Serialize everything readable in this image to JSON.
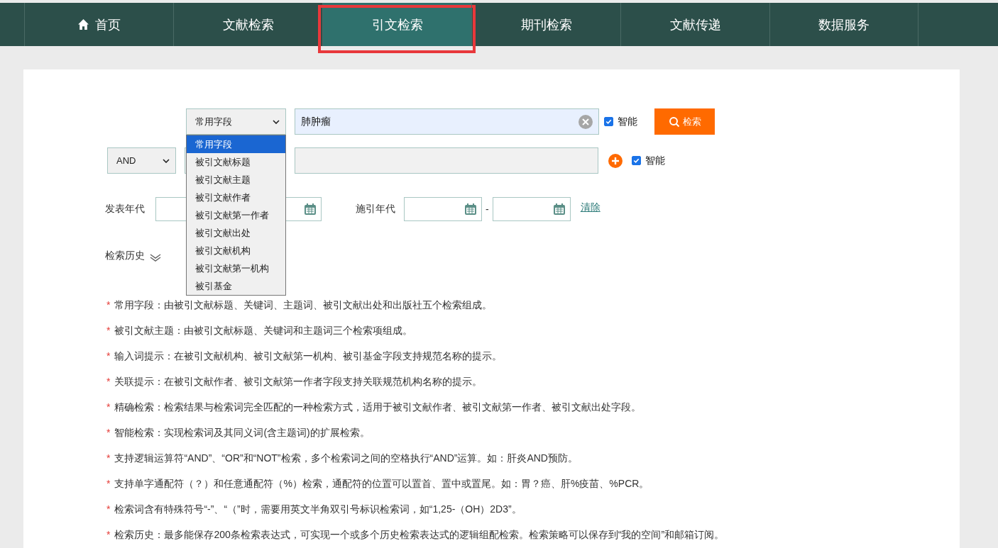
{
  "nav": {
    "tabs": [
      {
        "label": "首页",
        "kind": "home",
        "selected": false,
        "highlighted": false
      },
      {
        "label": "文献检索",
        "kind": "plain",
        "selected": false,
        "highlighted": false
      },
      {
        "label": "引文检索",
        "kind": "plain",
        "selected": true,
        "highlighted": true
      },
      {
        "label": "期刊检索",
        "kind": "plain",
        "selected": false,
        "highlighted": false
      },
      {
        "label": "文献传递",
        "kind": "plain",
        "selected": false,
        "highlighted": false
      },
      {
        "label": "数据服务",
        "kind": "plain",
        "selected": false,
        "highlighted": false
      }
    ]
  },
  "search": {
    "row1": {
      "field": "常用字段",
      "value": "肺肿瘤",
      "smart_label": "智能",
      "smart_checked": true,
      "button": "检索"
    },
    "row2": {
      "operator": "AND",
      "smart_label": "智能",
      "smart_checked": true
    },
    "field_dropdown": {
      "options": [
        {
          "label": "常用字段",
          "selected": true
        },
        {
          "label": "被引文献标题",
          "selected": false
        },
        {
          "label": "被引文献主题",
          "selected": false
        },
        {
          "label": "被引文献作者",
          "selected": false
        },
        {
          "label": "被引文献第一作者",
          "selected": false
        },
        {
          "label": "被引文献出处",
          "selected": false
        },
        {
          "label": "被引文献机构",
          "selected": false
        },
        {
          "label": "被引文献第一机构",
          "selected": false
        },
        {
          "label": "被引基金",
          "selected": false
        }
      ]
    },
    "publish_years_label": "发表年代",
    "citing_years_label": "施引年代",
    "range_separator": "-",
    "clear_link": "清除",
    "history_label": "检索历史"
  },
  "notes": [
    {
      "marker": "*",
      "text": "常用字段：由被引文献标题、关键词、主题词、被引文献出处和出版社五个检索组成。"
    },
    {
      "marker": "*",
      "text": "被引文献主题：由被引文献标题、关键词和主题词三个检索项组成。"
    },
    {
      "marker": "*",
      "text": "输入词提示：在被引文献机构、被引文献第一机构、被引基金字段支持规范名称的提示。"
    },
    {
      "marker": "*",
      "text": "关联提示：在被引文献作者、被引文献第一作者字段支持关联规范机构名称的提示。"
    },
    {
      "marker": "*",
      "text": "精确检索：检索结果与检索词完全匹配的一种检索方式，适用于被引文献作者、被引文献第一作者、被引文献出处字段。"
    },
    {
      "marker": "*",
      "text": "智能检索：实现检索词及其同义词(含主题词)的扩展检索。"
    },
    {
      "marker": "*",
      "text": "支持逻辑运算符“AND”、“OR”和“NOT”检索，多个检索词之间的空格执行“AND”运算。如：肝炎AND预防。"
    },
    {
      "marker": "*",
      "text": "支持单字通配符（？）和任意通配符（%）检索，通配符的位置可以置首、置中或置尾。如：胃？癌、肝%疫苗、%PCR。"
    },
    {
      "marker": "*",
      "text": "检索词含有特殊符号“-”、“（”时，需要用英文半角双引号标识检索词，如“1,25-（OH）2D3”。"
    },
    {
      "marker": "*",
      "text": "检索历史：最多能保存200条检索表达式，可实现一个或多个历史检索表达式的逻辑组配检索。检索策略可以保存到“我的空间”和邮箱订阅。"
    }
  ]
}
